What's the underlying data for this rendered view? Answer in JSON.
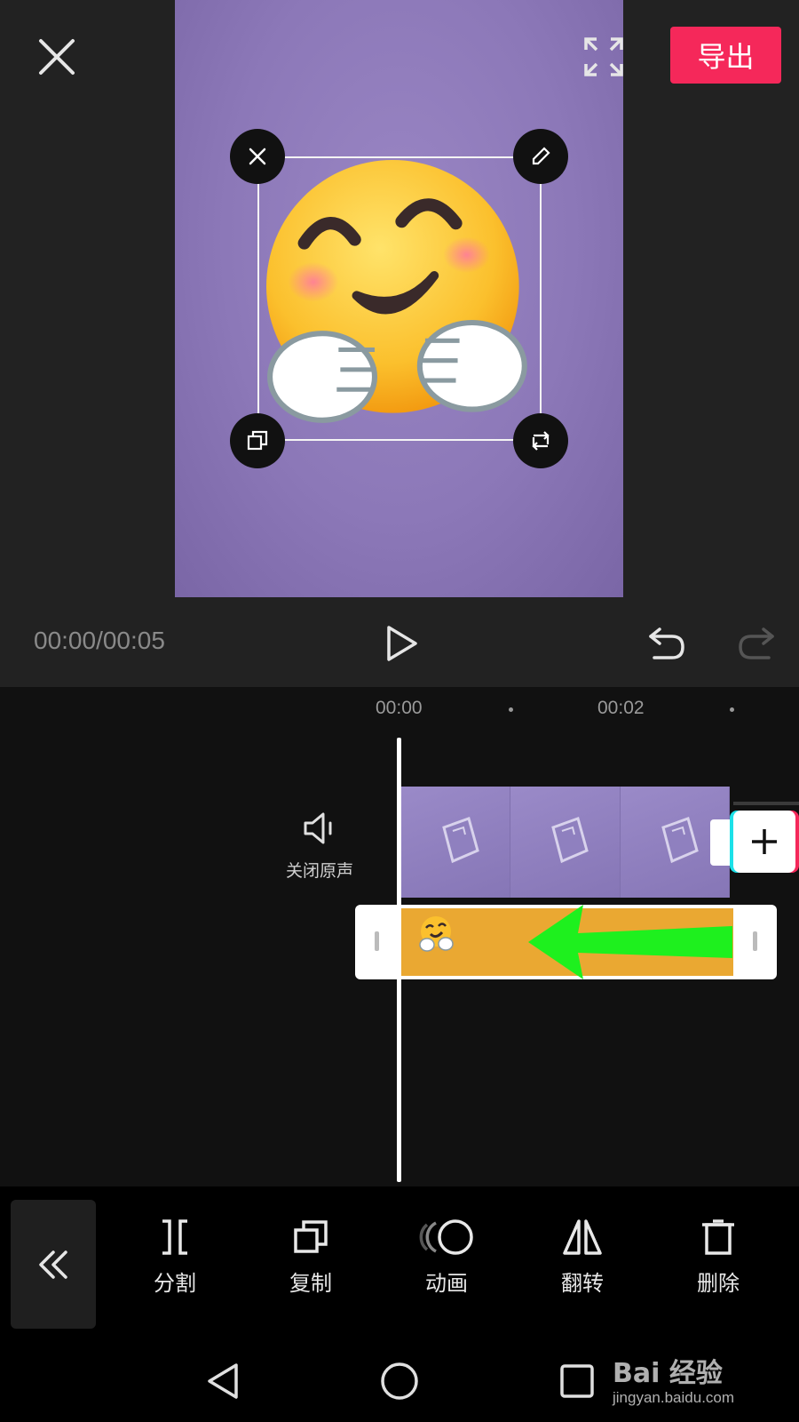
{
  "header": {
    "export_label": "导出"
  },
  "playback": {
    "time_readout": "00:00/00:05"
  },
  "timeline": {
    "ticks": [
      "00:00",
      "00:02"
    ],
    "mute_label": "关闭原声"
  },
  "toolbar": {
    "tools": [
      {
        "label": "分割",
        "icon": "split-icon"
      },
      {
        "label": "复制",
        "icon": "copy-icon"
      },
      {
        "label": "动画",
        "icon": "animation-icon"
      },
      {
        "label": "翻转",
        "icon": "flip-icon"
      },
      {
        "label": "删除",
        "icon": "delete-icon"
      }
    ]
  },
  "watermark": {
    "brand": "Bai 经验",
    "url": "jingyan.baidu.com"
  },
  "colors": {
    "accent": "#f5285a",
    "sticker_track": "#eaa832",
    "canvas_bg": "#8c78b8",
    "arrow": "#1ef01e"
  }
}
